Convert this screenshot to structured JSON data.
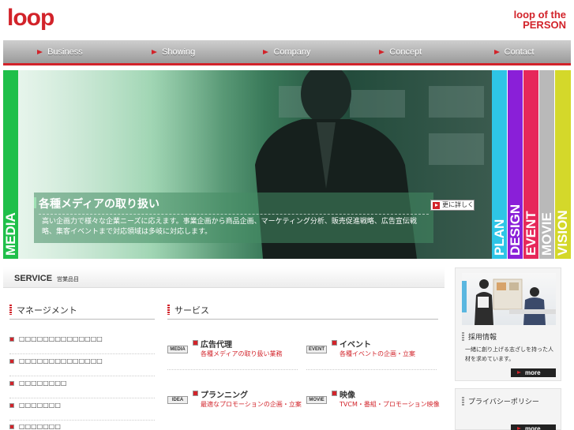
{
  "header": {
    "logo": "loop",
    "tagline_line1": "loop of the",
    "tagline_line2": "PERSON"
  },
  "nav": {
    "items": [
      {
        "label": "Business"
      },
      {
        "label": "Showing"
      },
      {
        "label": "Company"
      },
      {
        "label": "Concept"
      },
      {
        "label": "Contact"
      }
    ]
  },
  "hero": {
    "media_label": "MEDIA",
    "caption_title": "各種メディアの取り扱い",
    "caption_body": "高い企画力で様々な企業ニーズに応えます。事業企画から商品企画、マーケティング分析、販売促進戦略、広告宣伝戦略、集客イベントまで対応領域は多岐に対応します。",
    "detail_button": "更に詳しく",
    "tabs": [
      {
        "label": "PLAN",
        "color": "#2ec5e6"
      },
      {
        "label": "DESIGN",
        "color": "#8a1fd8"
      },
      {
        "label": "EVENT",
        "color": "#e6285a"
      },
      {
        "label": "MOVIE",
        "color": "#b9b9b9"
      },
      {
        "label": "VISION",
        "color": "#d4d82a"
      }
    ]
  },
  "service": {
    "title": "SERVICE",
    "subtitle": "営業品目",
    "management": {
      "title": "マネージメント",
      "items": [
        {
          "label": "□□□□□□□□□□□□□□"
        },
        {
          "label": "□□□□□□□□□□□□□□"
        },
        {
          "label": "□□□□□□□□"
        },
        {
          "label": "□□□□□□□"
        },
        {
          "label": "□□□□□□□"
        }
      ]
    },
    "services": {
      "title": "サービス",
      "items": [
        {
          "tag": "MEDIA",
          "name": "広告代理",
          "desc": "各種メディアの取り扱い業務"
        },
        {
          "tag": "EVENT",
          "name": "イベント",
          "desc": "各種イベントの企画・立案"
        },
        {
          "tag": "IDEA",
          "name": "プランニング",
          "desc": "最適なプロモーションの企画・立案"
        },
        {
          "tag": "MOVIE",
          "name": "映像",
          "desc": "TVCM・番組・プロモーション映像"
        }
      ]
    }
  },
  "sidebar": {
    "recruit": {
      "title": "採用情報",
      "desc": "一緒に創り上げる志ざしを持った人材を求めています。",
      "more": "more"
    },
    "privacy": {
      "title": "プライバシーポリシー",
      "more": "more"
    }
  },
  "colors": {
    "brand_red": "#d2232a",
    "media_green": "#1fbf4a"
  }
}
